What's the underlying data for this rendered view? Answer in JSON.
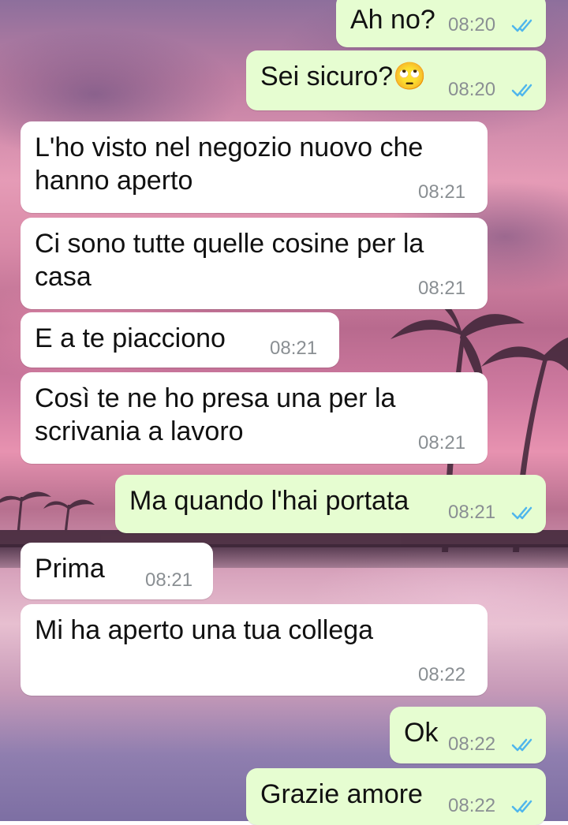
{
  "messages": [
    {
      "direction": "out",
      "text": "Ah no?",
      "time": "08:20",
      "read": true
    },
    {
      "direction": "out",
      "text": "Sei sicuro?🙄",
      "time": "08:20",
      "read": true
    },
    {
      "direction": "in",
      "text": "L'ho visto nel negozio nuovo che\nhanno aperto",
      "time": "08:21"
    },
    {
      "direction": "in",
      "text": "Ci sono tutte quelle cosine per la\ncasa",
      "time": "08:21"
    },
    {
      "direction": "in",
      "text": "E a te piacciono",
      "time": "08:21"
    },
    {
      "direction": "in",
      "text": "Così te ne ho presa una per la\nscrivania a lavoro",
      "time": "08:21"
    },
    {
      "direction": "out",
      "text": "Ma quando l'hai portata",
      "time": "08:21",
      "read": true
    },
    {
      "direction": "in",
      "text": "Prima",
      "time": "08:21"
    },
    {
      "direction": "in",
      "text": "Mi ha aperto una tua collega",
      "time": "08:22"
    },
    {
      "direction": "out",
      "text": "Ok",
      "time": "08:22",
      "read": true
    },
    {
      "direction": "out",
      "text": "Grazie amore",
      "time": "08:22",
      "read": true
    }
  ],
  "colors": {
    "incoming": "#ffffff",
    "outgoing": "#e6fdd1",
    "read_ticks": "#4fb6ec",
    "timestamp": "#8a8f93"
  },
  "icons": {
    "read_receipt": "double-check-icon"
  }
}
